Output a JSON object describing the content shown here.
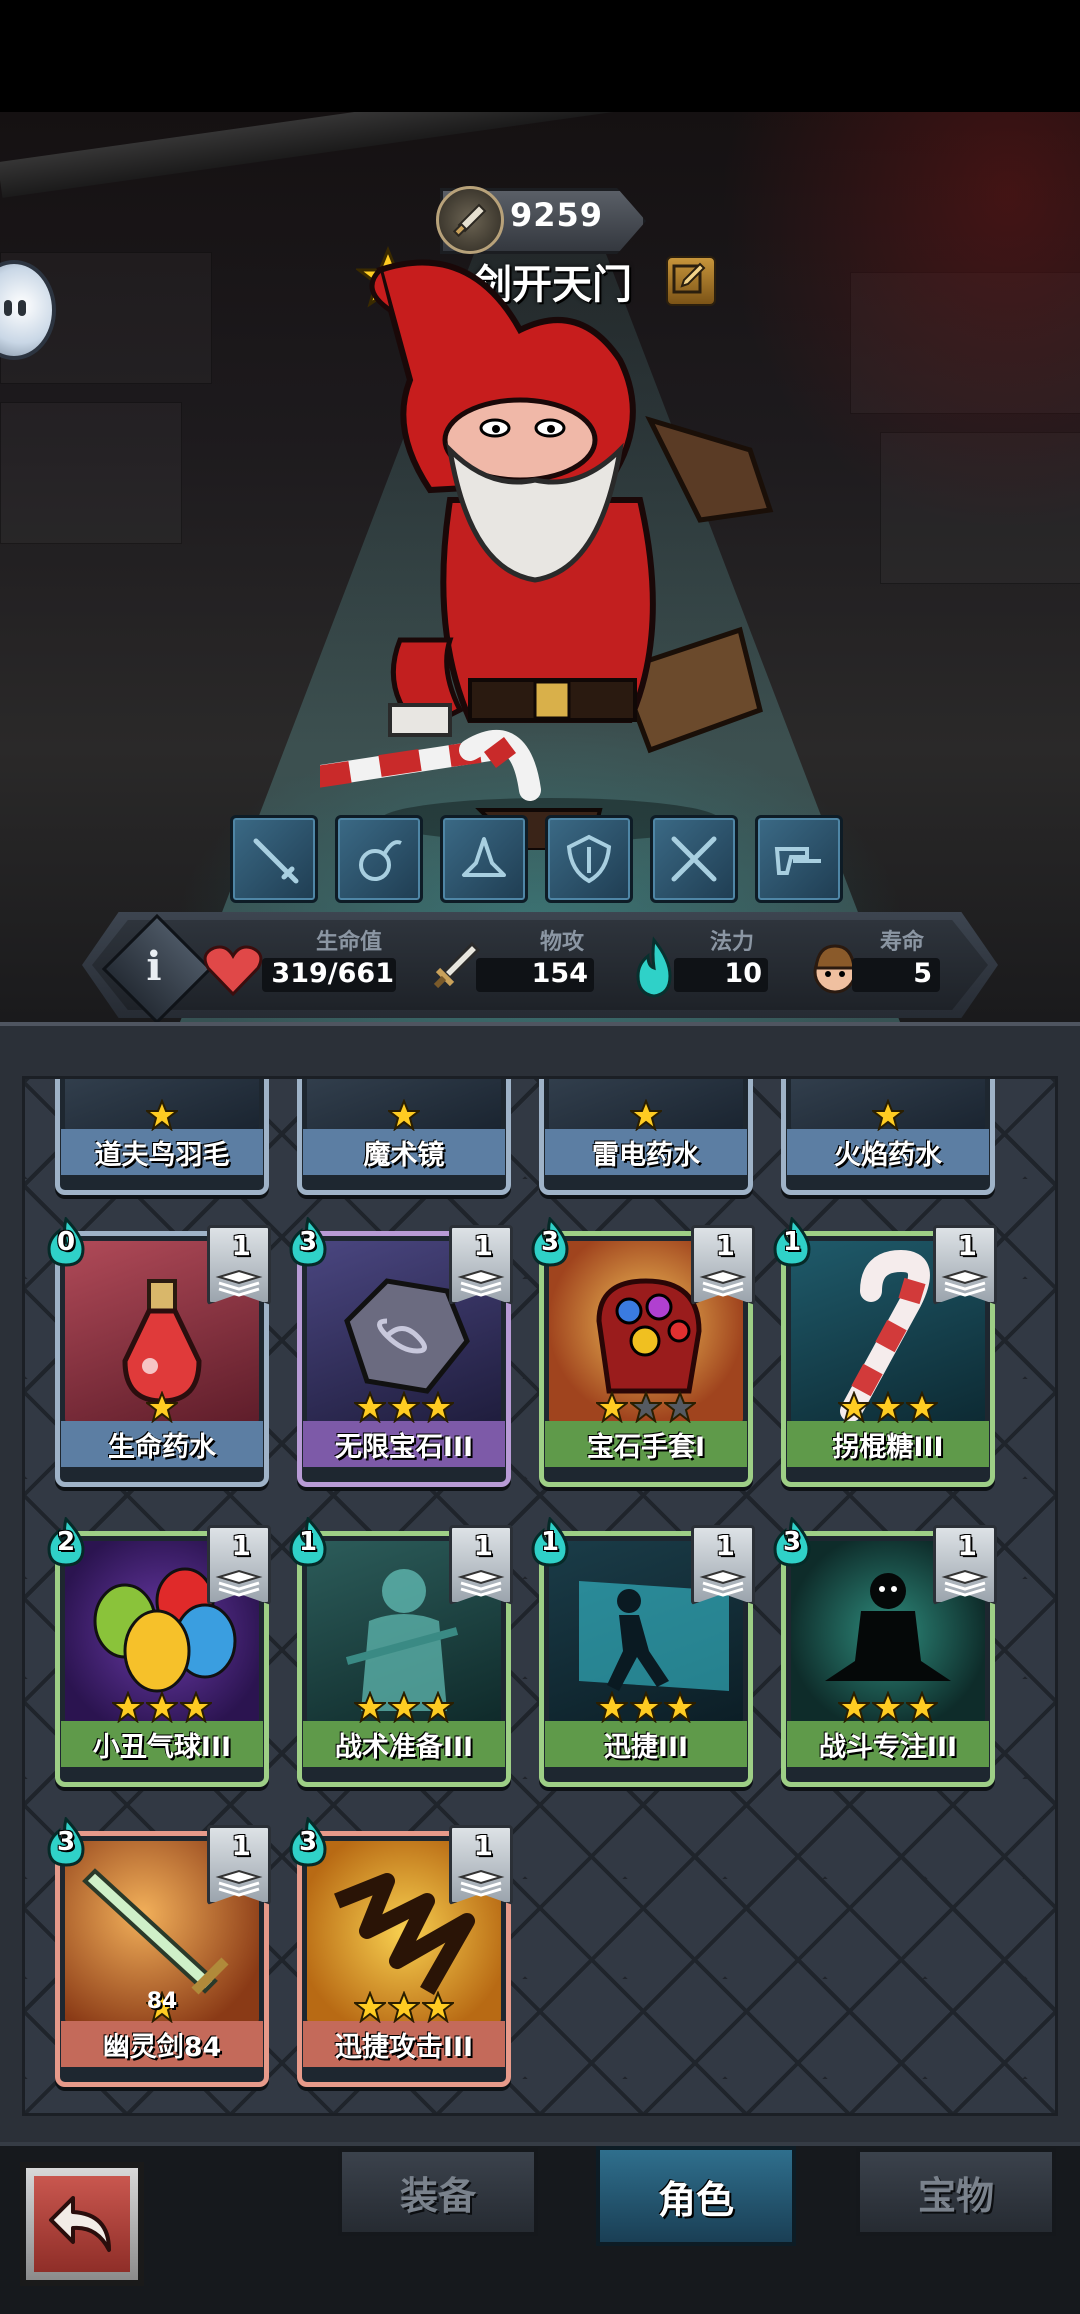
{
  "hero": {
    "power": "9259",
    "name": "一剑开天门"
  },
  "skills": [
    "sword-skill",
    "bomb-skill",
    "hat-skill",
    "shield-skill",
    "crossed-swords-skill",
    "pistols-skill"
  ],
  "stats": {
    "hp": {
      "label": "生命值",
      "value": "319/661",
      "icon": "heart-icon",
      "fraction": 0.483
    },
    "atk": {
      "label": "物攻",
      "value": "154",
      "icon": "sword-icon"
    },
    "mana": {
      "label": "法力",
      "value": "10",
      "icon": "mana-flame-icon"
    },
    "life": {
      "label": "寿命",
      "value": "5",
      "icon": "lifespan-icon"
    }
  },
  "inventory": {
    "partial_row": [
      {
        "name": "道夫鸟羽毛",
        "stars": 1
      },
      {
        "name": "魔术镜",
        "stars": 1
      },
      {
        "name": "雷电药水",
        "stars": 1
      },
      {
        "name": "火焰药水",
        "stars": 1
      }
    ],
    "cards": [
      {
        "name": "生命药水",
        "cost": "0",
        "level": "1",
        "stars": 1,
        "max_stars": 1,
        "rarity": "blue",
        "art": "potion"
      },
      {
        "name": "无限宝石III",
        "cost": "3",
        "level": "1",
        "stars": 3,
        "max_stars": 3,
        "rarity": "purple",
        "art": "gem"
      },
      {
        "name": "宝石手套I",
        "cost": "3",
        "level": "1",
        "stars": 1,
        "max_stars": 3,
        "rarity": "green",
        "art": "gauntlet"
      },
      {
        "name": "拐棍糖III",
        "cost": "1",
        "level": "1",
        "stars": 3,
        "max_stars": 3,
        "rarity": "green",
        "art": "candycane"
      },
      {
        "name": "小丑气球III",
        "cost": "2",
        "level": "1",
        "stars": 3,
        "max_stars": 3,
        "rarity": "green",
        "art": "balloons"
      },
      {
        "name": "战术准备III",
        "cost": "1",
        "level": "1",
        "stars": 3,
        "max_stars": 3,
        "rarity": "green",
        "art": "ghost"
      },
      {
        "name": "迅捷III",
        "cost": "1",
        "level": "1",
        "stars": 3,
        "max_stars": 3,
        "rarity": "green",
        "art": "dash"
      },
      {
        "name": "战斗专注III",
        "cost": "3",
        "level": "1",
        "stars": 3,
        "max_stars": 3,
        "rarity": "green",
        "art": "meditate"
      },
      {
        "name": "幽灵剑84",
        "cost": "3",
        "level": "1",
        "stars": 1,
        "max_stars": 1,
        "rarity": "red",
        "art": "sword",
        "weapon_level": "84"
      },
      {
        "name": "迅捷攻击III",
        "cost": "3",
        "level": "1",
        "stars": 3,
        "max_stars": 3,
        "rarity": "red",
        "art": "slash"
      }
    ]
  },
  "nav": {
    "tabs": [
      {
        "label": "装备",
        "active": false
      },
      {
        "label": "角色",
        "active": true
      },
      {
        "label": "宝物",
        "active": false
      }
    ]
  },
  "colors": {
    "blue": "#9fb3c8",
    "purple": "#b89bd6",
    "green": "#9ecf86",
    "red": "#e79a8a",
    "star": "#ffcc22",
    "mana": "#2fd1c8"
  }
}
